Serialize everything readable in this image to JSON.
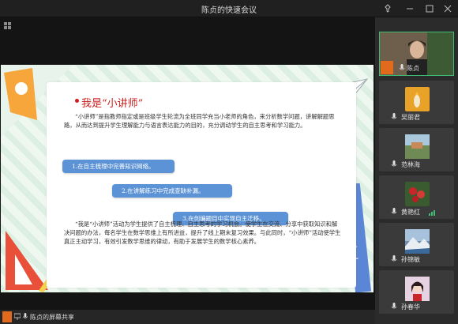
{
  "window": {
    "title": "陈贞的快速会议"
  },
  "slide": {
    "title": "我是“小讲师”",
    "paragraph1": "“小讲师”是指教师指定或是班级学生轮流为全班同学充当小老师的角色，来分析数学问题，讲解解题思路，从而达到提升学生理解能力与语言表达能力的目的，充分调动学生的自主思考和学习能力。",
    "pills": [
      "1.在自主梳理中完善知识网络。",
      "2.在讲解练习中完成查缺补漏。",
      "3.在创编题目中实现自主迁移。"
    ],
    "paragraph2": "“我是“小讲师”活动为学生提供了自主梳理、自主思考的学习机会。使学生在交流、分享中获取知识和解决问题的办法，每名学生在数学思维上有所进益，提升了线上期末复习效果。与此同时，“小讲师”活动使学生真正主动学习，有效引发数学思维的律动，有助于发展学生的数学核心素养。"
  },
  "participants": [
    {
      "name": "陈贞",
      "type": "camera"
    },
    {
      "name": "吴丽君",
      "avatar_color": "#e8a227"
    },
    {
      "name": "范林海",
      "avatar_color": "#7fa0b7"
    },
    {
      "name": "黄艳红",
      "avatar_color": "#3a5a2f"
    },
    {
      "name": "孙锦敏",
      "avatar_color": "#6f8fb0"
    },
    {
      "name": "孙春华",
      "avatar_color": "#c9a9c4"
    }
  ],
  "bottom": {
    "share_label": "陈贞的屏幕共享"
  },
  "icons": [
    "pin-icon",
    "minimize-icon",
    "maximize-icon",
    "close-icon",
    "grid-icon",
    "mic-icon",
    "signal-icon"
  ]
}
